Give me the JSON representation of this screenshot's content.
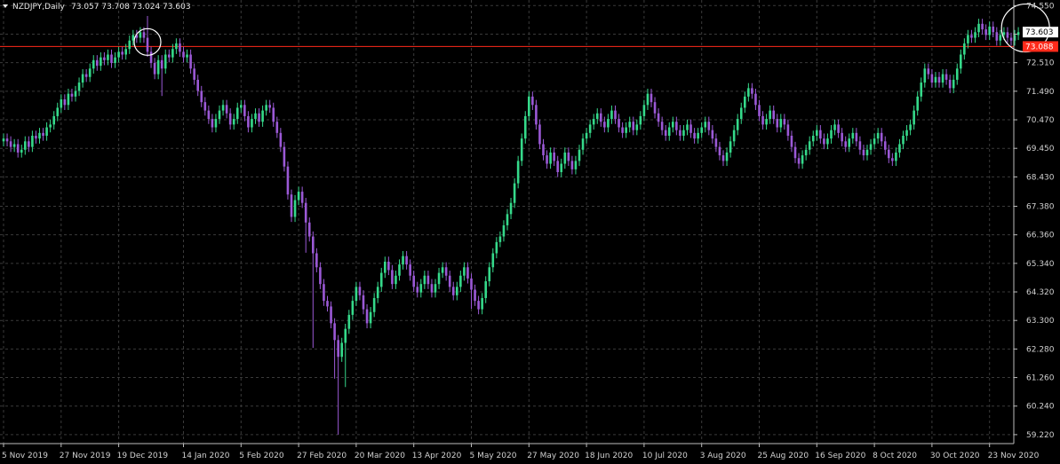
{
  "header": {
    "symbol": "NZDJPY,Daily",
    "ohlc": "73.057 73.708 73.024 73.603"
  },
  "colors": {
    "background": "#000000",
    "grid": "#3a3a3a",
    "bull": "#35d98a",
    "bear": "#9b59d6",
    "resistance": "#ff2a1a",
    "price_tag_bg": "#ffffff",
    "price_tag_fg": "#000000",
    "resistance_tag_bg": "#ff2a1a",
    "resistance_tag_fg": "#ffffff",
    "circle": "#ffffff",
    "text": "#d0d0d0"
  },
  "chart_data": {
    "type": "candlestick",
    "ylim": [
      58.9,
      74.75
    ],
    "y_ticks": [
      "74.550",
      "73.530",
      "72.510",
      "71.490",
      "70.470",
      "69.450",
      "68.430",
      "67.380",
      "66.360",
      "65.340",
      "64.320",
      "63.300",
      "62.280",
      "61.260",
      "60.240",
      "59.220"
    ],
    "y_tick_values": [
      74.55,
      73.53,
      72.51,
      71.49,
      70.47,
      69.45,
      68.43,
      67.38,
      66.36,
      65.34,
      64.32,
      63.3,
      62.28,
      61.26,
      60.24,
      59.22
    ],
    "x_ticks": [
      "5 Nov 2019",
      "27 Nov 2019",
      "19 Dec 2019",
      "14 Jan 2020",
      "5 Feb 2020",
      "27 Feb 2020",
      "20 Mar 2020",
      "13 Apr 2020",
      "5 May 2020",
      "27 May 2020",
      "18 Jun 2020",
      "10 Jul 2020",
      "3 Aug 2020",
      "25 Aug 2020",
      "16 Sep 2020",
      "8 Oct 2020",
      "30 Oct 2020",
      "23 Nov 2020"
    ],
    "x_tick_index": [
      0,
      16,
      32,
      50,
      66,
      82,
      98,
      114,
      130,
      146,
      162,
      178,
      194,
      210,
      226,
      242,
      258,
      274
    ],
    "current_price": 73.603,
    "current_price_label": "73.603",
    "resistance_level": 73.088,
    "resistance_label": "73.088",
    "highlight_circles": [
      {
        "index": 40,
        "price": 73.25
      },
      {
        "index": 284,
        "price": 73.75
      }
    ],
    "closes": [
      69.8,
      69.7,
      69.5,
      69.6,
      69.3,
      69.4,
      69.7,
      69.5,
      69.9,
      69.8,
      70.0,
      69.9,
      70.2,
      70.3,
      70.6,
      70.9,
      71.2,
      71.0,
      71.4,
      71.3,
      71.5,
      71.8,
      72.1,
      72.0,
      72.3,
      72.6,
      72.4,
      72.7,
      72.6,
      72.8,
      72.5,
      72.7,
      72.9,
      72.8,
      73.0,
      73.3,
      73.5,
      73.4,
      73.6,
      73.4,
      72.9,
      72.5,
      72.1,
      72.6,
      72.3,
      72.8,
      72.7,
      73.0,
      73.2,
      72.9,
      72.7,
      72.8,
      72.3,
      71.9,
      71.5,
      71.1,
      70.8,
      70.5,
      70.2,
      70.5,
      70.8,
      71.0,
      70.7,
      70.3,
      70.5,
      70.9,
      71.0,
      70.6,
      70.2,
      70.5,
      70.7,
      70.4,
      70.8,
      71.0,
      70.9,
      70.4,
      70.0,
      69.5,
      68.8,
      67.8,
      67.0,
      67.6,
      67.9,
      67.5,
      66.8,
      66.3,
      65.7,
      65.2,
      64.6,
      64.0,
      63.8,
      63.2,
      62.6,
      62.0,
      62.5,
      63.0,
      63.5,
      64.0,
      64.5,
      64.2,
      63.7,
      63.2,
      63.6,
      64.1,
      64.5,
      65.0,
      65.4,
      65.1,
      64.6,
      64.9,
      65.3,
      65.6,
      65.3,
      64.9,
      64.5,
      64.3,
      64.6,
      64.9,
      64.6,
      64.3,
      64.6,
      65.0,
      65.2,
      64.9,
      64.5,
      64.2,
      64.5,
      64.9,
      65.2,
      64.8,
      64.4,
      64.0,
      63.7,
      64.1,
      64.7,
      65.2,
      65.7,
      66.1,
      66.3,
      66.7,
      67.1,
      67.5,
      68.2,
      69.0,
      69.8,
      70.6,
      71.3,
      71.0,
      70.3,
      69.6,
      69.2,
      68.9,
      69.3,
      69.0,
      68.6,
      68.9,
      69.3,
      69.0,
      68.7,
      69.0,
      69.4,
      69.8,
      70.0,
      70.3,
      70.5,
      70.7,
      70.4,
      70.2,
      70.5,
      70.8,
      70.5,
      70.2,
      70.0,
      70.2,
      70.4,
      70.1,
      70.3,
      70.6,
      71.0,
      71.4,
      71.1,
      70.7,
      70.4,
      70.1,
      69.9,
      70.2,
      70.4,
      70.1,
      69.9,
      70.1,
      70.3,
      70.0,
      69.8,
      70.0,
      70.2,
      70.4,
      70.1,
      69.8,
      69.5,
      69.2,
      69.0,
      69.3,
      69.7,
      70.1,
      70.5,
      70.9,
      71.3,
      71.6,
      71.4,
      71.0,
      70.6,
      70.3,
      70.5,
      70.8,
      70.5,
      70.2,
      70.5,
      70.3,
      69.9,
      69.5,
      69.1,
      68.9,
      69.2,
      69.4,
      69.7,
      69.9,
      70.1,
      69.8,
      69.6,
      69.8,
      70.1,
      70.3,
      70.0,
      69.7,
      69.5,
      69.8,
      70.0,
      69.7,
      69.4,
      69.2,
      69.4,
      69.6,
      69.8,
      70.0,
      69.7,
      69.4,
      69.1,
      69.0,
      69.3,
      69.6,
      69.9,
      70.1,
      70.3,
      70.8,
      71.3,
      71.8,
      72.3,
      72.1,
      71.8,
      72.0,
      71.8,
      72.1,
      71.9,
      71.6,
      71.9,
      72.3,
      72.8,
      73.2,
      73.5,
      73.4,
      73.6,
      73.9,
      73.7,
      73.5,
      73.8,
      73.6,
      73.3,
      73.5,
      73.6,
      73.4,
      73.3,
      73.5,
      73.6
    ]
  }
}
